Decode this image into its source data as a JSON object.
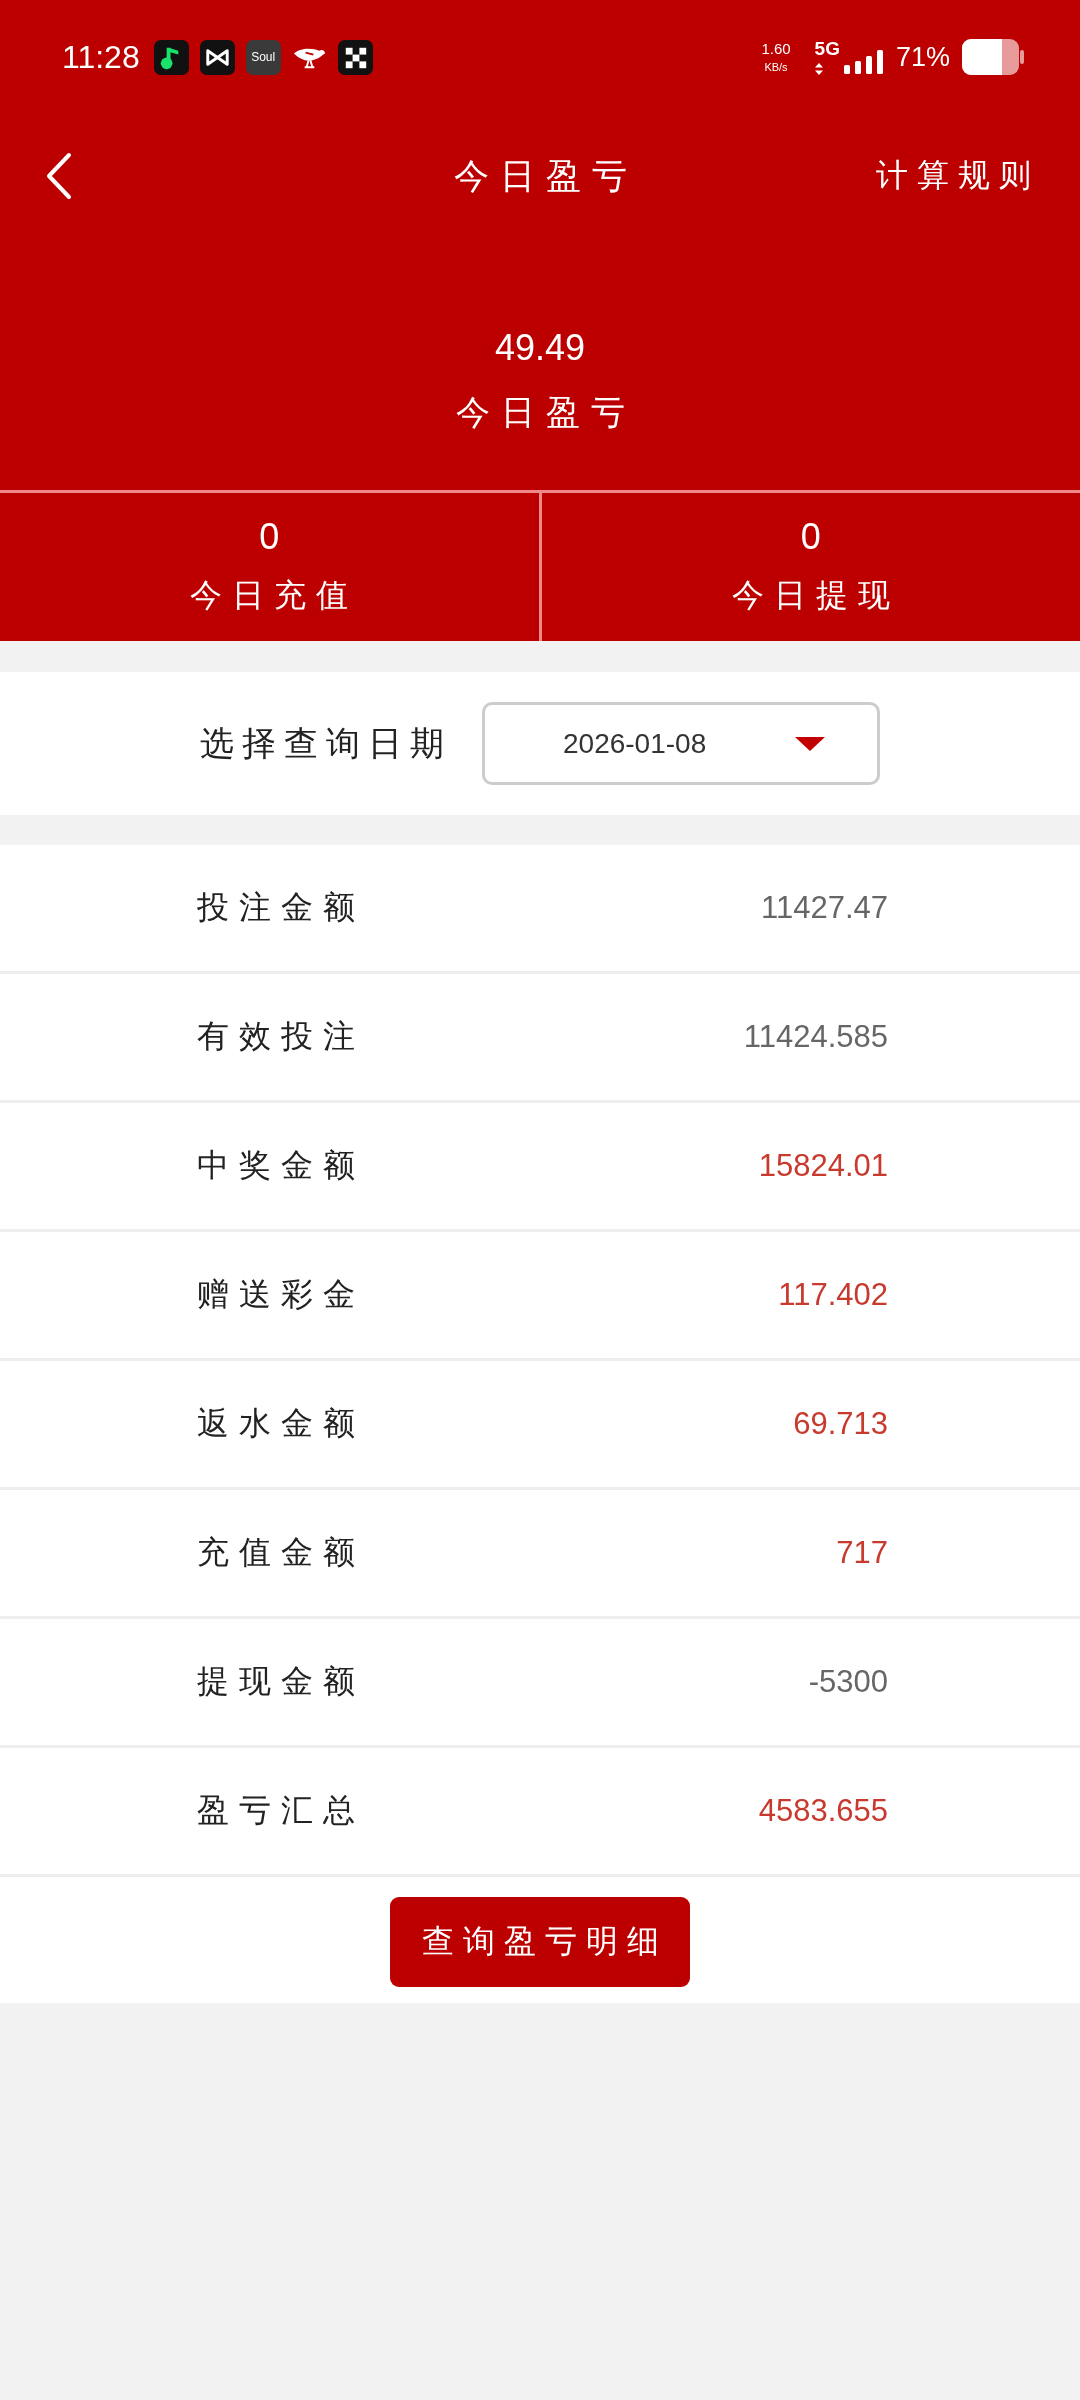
{
  "status_bar": {
    "time": "11:28",
    "notifications": [
      {
        "kind": "note"
      },
      {
        "kind": "bowtie"
      },
      {
        "kind": "logo",
        "label": "Soul"
      },
      {
        "kind": "bird"
      },
      {
        "kind": "checker"
      }
    ],
    "net_speed": "1.60",
    "net_unit": "KB/s",
    "network": "5G",
    "battery": "71%"
  },
  "header": {
    "title": "今日盈亏",
    "action": "计算规则"
  },
  "summary": {
    "value": "49.49",
    "label": "今日盈亏"
  },
  "stats": [
    {
      "value": "0",
      "label": "今日充值"
    },
    {
      "value": "0",
      "label": "今日提现"
    }
  ],
  "date_filter": {
    "label": "选择查询日期",
    "value": "2026-01-08"
  },
  "rows": [
    {
      "label": "投注金额",
      "value": "11427.47",
      "color": "#666666"
    },
    {
      "label": "有效投注",
      "value": "11424.585",
      "color": "#666666"
    },
    {
      "label": "中奖金额",
      "value": "15824.01",
      "color": "#c8392e"
    },
    {
      "label": "赠送彩金",
      "value": "117.402",
      "color": "#c8392e"
    },
    {
      "label": "返水金额",
      "value": "69.713",
      "color": "#c8392e"
    },
    {
      "label": "充值金额",
      "value": "717",
      "color": "#c8392e"
    },
    {
      "label": "提现金额",
      "value": "-5300",
      "color": "#666666"
    },
    {
      "label": "盈亏汇总",
      "value": "4583.655",
      "color": "#c8392e"
    }
  ],
  "button": "查询盈亏明细"
}
